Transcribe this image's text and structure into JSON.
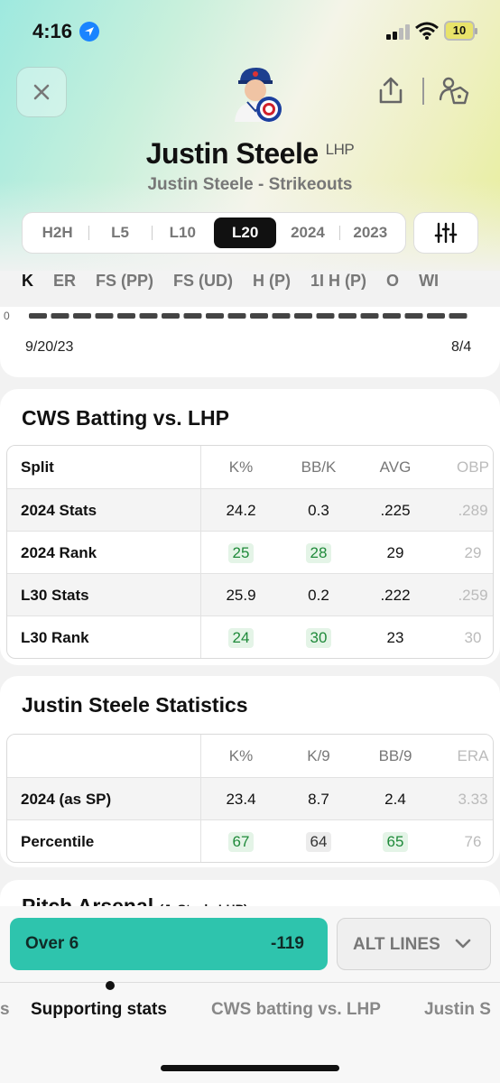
{
  "status_bar": {
    "time": "4:16",
    "battery": "10"
  },
  "player": {
    "name": "Justin Steele",
    "position": "LHP",
    "prop": "Justin Steele - Strikeouts"
  },
  "range_tabs": [
    {
      "label": "H2H",
      "active": false
    },
    {
      "label": "L5",
      "active": false
    },
    {
      "label": "L10",
      "active": false
    },
    {
      "label": "L20",
      "active": true
    },
    {
      "label": "2024",
      "active": false
    },
    {
      "label": "2023",
      "active": false
    }
  ],
  "stat_tabs": [
    "K",
    "ER",
    "FS (PP)",
    "FS (UD)",
    "H (P)",
    "1I H (P)",
    "O",
    "WI"
  ],
  "chart": {
    "zero_label": "0",
    "start_date": "9/20/23",
    "end_date": "8/4"
  },
  "batting": {
    "title": "CWS Batting vs. LHP",
    "headers": [
      "Split",
      "K%",
      "BB/K",
      "AVG",
      "OBP"
    ],
    "rows": [
      {
        "label": "2024 Stats",
        "c1": "24.2",
        "c2": "0.3",
        "c3": ".225",
        "c4": ".289"
      },
      {
        "label": "2024 Rank",
        "c1": "25",
        "c2": "28",
        "c3": "29",
        "c4": "29"
      },
      {
        "label": "L30 Stats",
        "c1": "25.9",
        "c2": "0.2",
        "c3": ".222",
        "c4": ".259"
      },
      {
        "label": "L30 Rank",
        "c1": "24",
        "c2": "30",
        "c3": "23",
        "c4": "30"
      }
    ]
  },
  "pitcher_stats": {
    "title": "Justin Steele Statistics",
    "headers": [
      "",
      "K%",
      "K/9",
      "BB/9",
      "ERA"
    ],
    "rows": [
      {
        "label": "2024 (as SP)",
        "c1": "23.4",
        "c2": "8.7",
        "c3": "2.4",
        "c4": "3.33"
      },
      {
        "label": "Percentile",
        "c1": "67",
        "c2": "64",
        "c3": "65",
        "c4": "76"
      }
    ]
  },
  "pitch_arsenal": {
    "title": "Pitch Arsenal",
    "sub": "(J. Steele LHP)"
  },
  "bet": {
    "over_label": "Over 6",
    "over_odds": "-119",
    "alt_label": "ALT LINES"
  },
  "bottom_tabs": [
    "s",
    "Supporting stats",
    "CWS batting vs. LHP",
    "Justin S"
  ],
  "colors": {
    "accent": "#2ec4ad",
    "good_pill": "#e4f4e7",
    "good_text": "#1f8a3a"
  }
}
